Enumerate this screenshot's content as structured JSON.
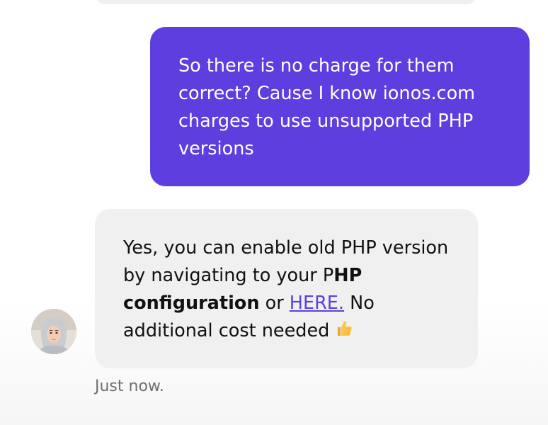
{
  "conversation": {
    "previous_bubble": "",
    "user_message": {
      "text": "So there is no charge for them correct? Cause I know ionos.com charges to use unsupported PHP versions"
    },
    "agent_message": {
      "part1": "Yes, you can enable old PHP version by navigating to your P",
      "bold": "HP configuration",
      "part2": " or ",
      "link_text": "HERE.",
      "part3": " No additional cost needed ",
      "emoji_icon": "thumbs-up-icon"
    },
    "timestamp": "Just now.",
    "avatar_icon": "agent-avatar"
  },
  "colors": {
    "user_bubble": "#5e3ede",
    "agent_bubble": "#f0f0f0",
    "link": "#5e3ede",
    "timestamp": "#6f6f6f"
  }
}
